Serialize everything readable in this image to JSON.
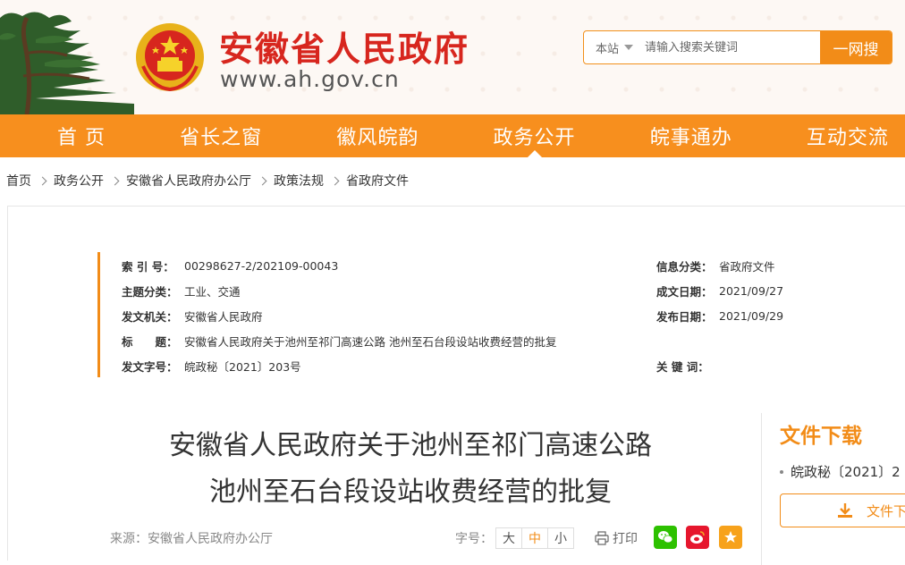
{
  "header": {
    "title": "安徽省人民政府",
    "url": "www.ah.gov.cn",
    "search": {
      "scope": "本站",
      "placeholder": "请输入搜索关键词",
      "button": "一网搜"
    }
  },
  "nav": {
    "items": [
      "首 页",
      "省长之窗",
      "徽风皖韵",
      "政务公开",
      "皖事通办",
      "互动交流"
    ],
    "active": "政务公开"
  },
  "breadcrumb": [
    "首页",
    "政务公开",
    "安徽省人民政府办公厅",
    "政策法规",
    "省政府文件"
  ],
  "meta": {
    "index_no": {
      "label": "索 引 号：",
      "value": "00298627-2/202109-00043"
    },
    "category": {
      "label": "主题分类：",
      "value": "工业、交通"
    },
    "issuer": {
      "label": "发文机关：",
      "value": "安徽省人民政府"
    },
    "subject": {
      "label": "标　　题：",
      "value": "安徽省人民政府关于池州至祁门高速公路 池州至石台段设站收费经营的批复"
    },
    "doc_no": {
      "label": "发文字号：",
      "value": "皖政秘〔2021〕203号"
    },
    "info_type": {
      "label": "信息分类：",
      "value": "省政府文件"
    },
    "created": {
      "label": "成文日期：",
      "value": "2021/09/27"
    },
    "published": {
      "label": "发布日期：",
      "value": "2021/09/29"
    },
    "keywords": {
      "label": "关 键 词：",
      "value": ""
    }
  },
  "article": {
    "title_line1": "安徽省人民政府关于池州至祁门高速公路",
    "title_line2": "池州至石台段设站收费经营的批复",
    "source": "来源：安徽省人民政府办公厅",
    "font_label": "字号：",
    "font_sizes": [
      "大",
      "中",
      "小"
    ],
    "font_active": "中",
    "print": "打印"
  },
  "download": {
    "title": "文件下载",
    "item": "皖政秘〔2021〕2",
    "button": "文件下"
  },
  "colors": {
    "brand_orange": "#f78f1e",
    "title_red": "#d7261e"
  }
}
